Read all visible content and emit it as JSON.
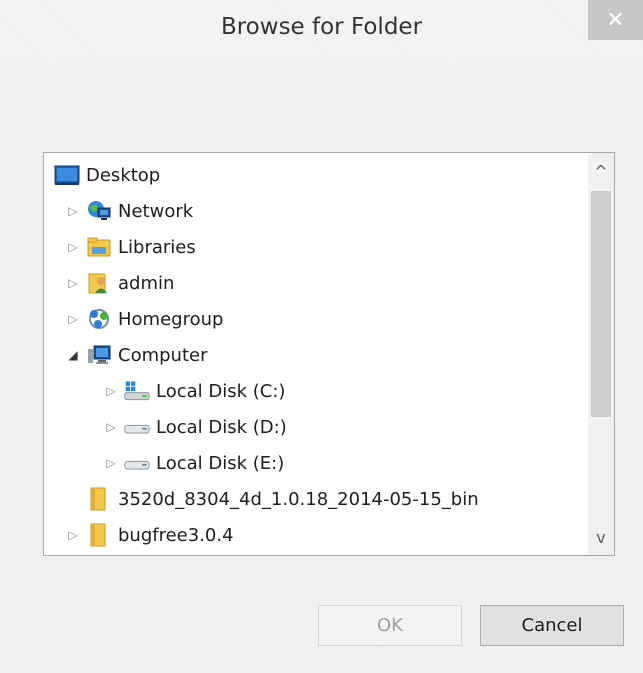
{
  "dialog": {
    "title": "Browse for Folder",
    "close_glyph": "✕"
  },
  "tree": {
    "items": [
      {
        "label": "Desktop",
        "icon": "desktop-icon",
        "expander": ""
      },
      {
        "label": "Network",
        "icon": "network-icon",
        "expander": "▷"
      },
      {
        "label": "Libraries",
        "icon": "libraries-icon",
        "expander": "▷"
      },
      {
        "label": "admin",
        "icon": "user-folder-icon",
        "expander": "▷"
      },
      {
        "label": "Homegroup",
        "icon": "homegroup-icon",
        "expander": "▷"
      },
      {
        "label": "Computer",
        "icon": "computer-icon",
        "expander": "◢"
      },
      {
        "label": "Local Disk (C:)",
        "icon": "system-drive-icon",
        "expander": "▷"
      },
      {
        "label": "Local Disk (D:)",
        "icon": "drive-icon",
        "expander": "▷"
      },
      {
        "label": "Local Disk (E:)",
        "icon": "drive-icon",
        "expander": "▷"
      },
      {
        "label": "3520d_8304_4d_1.0.18_2014-05-15_bin",
        "icon": "folder-icon",
        "expander": ""
      },
      {
        "label": "bugfree3.0.4",
        "icon": "folder-icon",
        "expander": "▷"
      }
    ]
  },
  "scrollbar": {
    "up_glyph": "^",
    "down_glyph": "v"
  },
  "buttons": {
    "ok_label": "OK",
    "cancel_label": "Cancel"
  }
}
